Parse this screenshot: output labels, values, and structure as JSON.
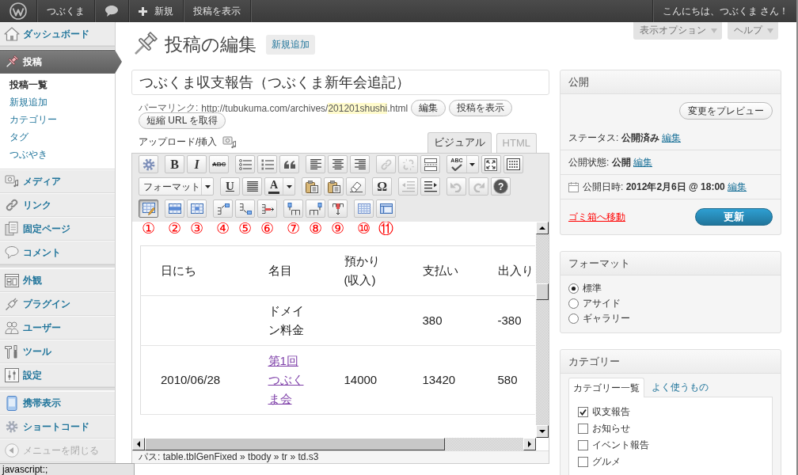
{
  "admin_bar": {
    "site_name": "つぶくま",
    "new_label": "新規",
    "view_post": "投稿を表示",
    "greeting": "こんにちは、つぶくま さん！"
  },
  "sidebar": {
    "groups": [
      [
        {
          "label": "ダッシュボード",
          "selected": false
        }
      ],
      [
        {
          "label": "投稿",
          "selected": true,
          "children": [
            {
              "label": "投稿一覧",
              "selected": true
            },
            {
              "label": "新規追加",
              "selected": false
            },
            {
              "label": "カテゴリー",
              "selected": false
            },
            {
              "label": "タグ",
              "selected": false
            },
            {
              "label": "つぶやき",
              "selected": false
            }
          ]
        },
        {
          "label": "メディア",
          "selected": false
        },
        {
          "label": "リンク",
          "selected": false
        },
        {
          "label": "固定ページ",
          "selected": false
        },
        {
          "label": "コメント",
          "selected": false
        }
      ],
      [
        {
          "label": "外観",
          "selected": false
        },
        {
          "label": "プラグイン",
          "selected": false
        },
        {
          "label": "ユーザー",
          "selected": false
        },
        {
          "label": "ツール",
          "selected": false
        },
        {
          "label": "設定",
          "selected": false
        }
      ],
      [
        {
          "label": "携帯表示",
          "selected": false
        },
        {
          "label": "ショートコード",
          "selected": false
        }
      ]
    ],
    "collapse": "メニューを閉じる"
  },
  "screen_tabs": [
    "表示オプション",
    "ヘルプ"
  ],
  "page": {
    "title": "投稿の編集",
    "add_new": "新規追加"
  },
  "post_title": "つぶくま収支報告（つぶくま新年会追記）",
  "permalink": {
    "label": "パーマリンク:",
    "url": "http://tubukuma.com/archives/",
    "slug": "201201shushi",
    "suffix": ".html",
    "buttons": [
      "編集",
      "投稿を表示",
      "短縮 URL を取得"
    ]
  },
  "editor": {
    "upload_label": "アップロード/挿入",
    "tabs": [
      {
        "label": "ビジュアル",
        "selected": true
      },
      {
        "label": "HTML",
        "selected": false
      }
    ],
    "toolbar": [
      [
        [
          {
            "kind": "button",
            "disabled": false,
            "pressed": false
          }
        ],
        [
          {
            "kind": "button",
            "label": "B",
            "disabled": false,
            "pressed": false
          },
          {
            "kind": "button",
            "label": "I",
            "disabled": false,
            "pressed": false
          },
          {
            "kind": "button",
            "label": "ABC",
            "disabled": false,
            "pressed": false
          }
        ],
        [
          {
            "kind": "button",
            "disabled": false,
            "pressed": false
          },
          {
            "kind": "button",
            "disabled": false,
            "pressed": false
          },
          {
            "kind": "button",
            "disabled": false,
            "pressed": false
          }
        ],
        [
          {
            "kind": "button",
            "disabled": false,
            "pressed": false
          },
          {
            "kind": "button",
            "disabled": false,
            "pressed": false
          },
          {
            "kind": "button",
            "disabled": false,
            "pressed": false
          }
        ],
        [
          {
            "kind": "button",
            "disabled": true,
            "pressed": false
          },
          {
            "kind": "button",
            "disabled": true,
            "pressed": false
          },
          {
            "kind": "button",
            "disabled": false,
            "pressed": false
          }
        ],
        [
          {
            "kind": "split",
            "label": "ABC",
            "disabled": false,
            "pressed": false
          },
          {
            "kind": "button",
            "disabled": false,
            "pressed": false
          },
          {
            "kind": "button",
            "disabled": false,
            "pressed": false
          }
        ]
      ],
      [
        [
          {
            "kind": "select",
            "label": "フォーマット",
            "disabled": false,
            "pressed": false
          }
        ],
        [
          {
            "kind": "button",
            "label": "U",
            "disabled": false,
            "pressed": false
          },
          {
            "kind": "button",
            "disabled": false,
            "pressed": false
          },
          {
            "kind": "split",
            "label": "A",
            "disabled": false,
            "pressed": false
          }
        ],
        [
          {
            "kind": "button",
            "disabled": false,
            "pressed": false
          },
          {
            "kind": "button",
            "disabled": false,
            "pressed": false
          },
          {
            "kind": "button",
            "disabled": false,
            "pressed": false
          }
        ],
        [
          {
            "kind": "button",
            "label": "Ω",
            "disabled": false,
            "pressed": false
          }
        ],
        [
          {
            "kind": "button",
            "disabled": true,
            "pressed": false
          },
          {
            "kind": "button",
            "disabled": false,
            "pressed": false
          }
        ],
        [
          {
            "kind": "button",
            "disabled": true,
            "pressed": false
          },
          {
            "kind": "button",
            "disabled": true,
            "pressed": false
          },
          {
            "kind": "button",
            "label": "?",
            "disabled": false,
            "pressed": false
          }
        ]
      ],
      [
        [
          {
            "kind": "button",
            "disabled": false,
            "pressed": true,
            "annotation": "①"
          }
        ],
        [
          {
            "kind": "button",
            "disabled": false,
            "pressed": false,
            "annotation": "②"
          },
          {
            "kind": "button",
            "disabled": false,
            "pressed": false,
            "annotation": "③"
          }
        ],
        [
          {
            "kind": "button",
            "disabled": false,
            "pressed": false,
            "annotation": "④"
          },
          {
            "kind": "button",
            "disabled": false,
            "pressed": false,
            "annotation": "⑤"
          },
          {
            "kind": "button",
            "disabled": false,
            "pressed": false,
            "annotation": "⑥"
          }
        ],
        [
          {
            "kind": "button",
            "disabled": false,
            "pressed": false,
            "annotation": "⑦"
          },
          {
            "kind": "button",
            "disabled": false,
            "pressed": false,
            "annotation": "⑧"
          },
          {
            "kind": "button",
            "disabled": false,
            "pressed": false,
            "annotation": "⑨"
          }
        ],
        [
          {
            "kind": "button",
            "disabled": false,
            "pressed": false,
            "annotation": "⑩"
          },
          {
            "kind": "button",
            "disabled": false,
            "pressed": false,
            "annotation": "⑪"
          }
        ]
      ]
    ],
    "table": {
      "columns": [
        "日にち",
        "名目",
        "預かり(収入)",
        "支払い",
        "出入り"
      ],
      "rows": [
        [
          null,
          {
            "text": "ドメイン料金",
            "link": false
          },
          null,
          {
            "text": "380",
            "link": false
          },
          {
            "text": "-380",
            "link": false
          }
        ],
        [
          {
            "text": "2010/06/28",
            "link": false
          },
          {
            "text": "第1回つぶくま会",
            "link": true
          },
          {
            "text": "14000",
            "link": false
          },
          {
            "text": "13420",
            "link": false
          },
          {
            "text": "580",
            "link": false
          }
        ]
      ]
    },
    "path": "パス: table.tblGenFixed » tbody » tr » td.s3"
  },
  "publish": {
    "title": "公開",
    "preview": "変更をプレビュー",
    "rows": [
      {
        "kind": "status",
        "label": "ステータス:",
        "value": "公開済み",
        "action": "編集"
      },
      {
        "kind": "visibility",
        "label": "公開状態:",
        "value": "公開",
        "action": "編集"
      },
      {
        "kind": "schedule",
        "label": "公開日時:",
        "value": "2012年2月6日 @ 18:00",
        "action": "編集"
      }
    ],
    "trash": "ゴミ箱へ移動",
    "update": "更新"
  },
  "format": {
    "title": "フォーマット",
    "options": [
      {
        "label": "標準",
        "selected": true
      },
      {
        "label": "アサイド",
        "selected": false
      },
      {
        "label": "ギャラリー",
        "selected": false
      }
    ]
  },
  "categories": {
    "title": "カテゴリー",
    "tabs": [
      {
        "label": "カテゴリー一覧",
        "selected": true
      },
      {
        "label": "よく使うもの",
        "selected": false
      }
    ],
    "items": [
      {
        "label": "収支報告",
        "checked": true
      },
      {
        "label": "お知らせ",
        "checked": false
      },
      {
        "label": "イベント報告",
        "checked": false
      },
      {
        "label": "グルメ",
        "checked": false
      }
    ]
  },
  "status_bar": "javascript:;"
}
